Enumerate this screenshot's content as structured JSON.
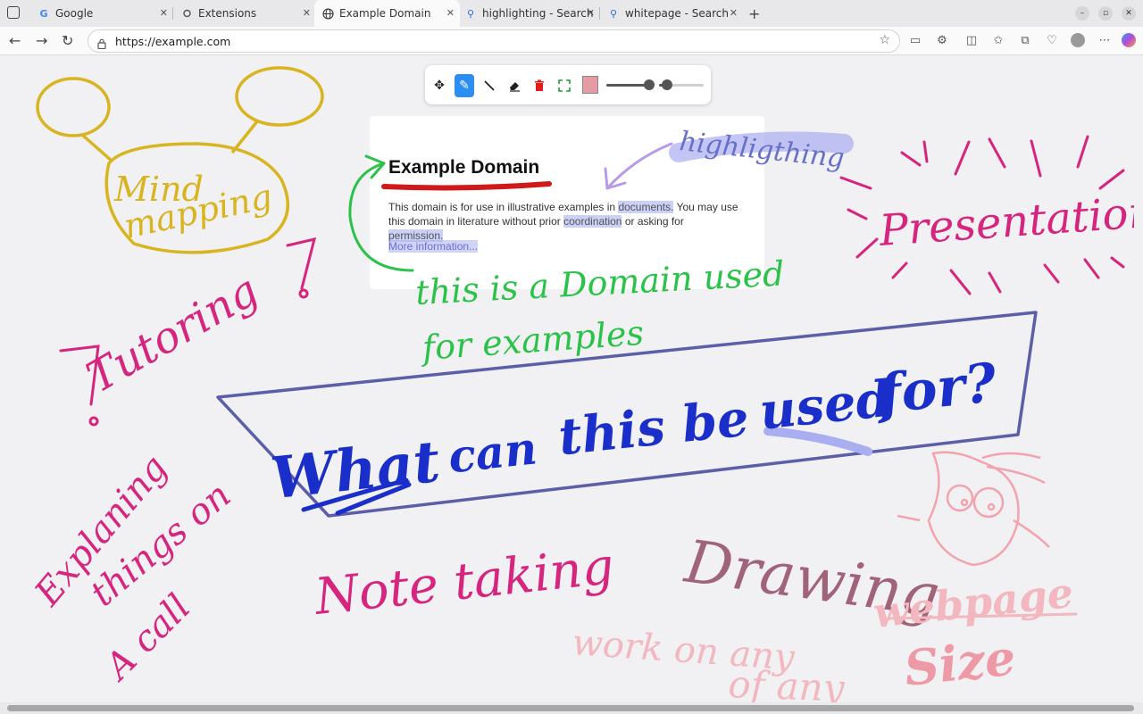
{
  "tabs": [
    {
      "title": "Google",
      "icon": "google-icon",
      "active": false
    },
    {
      "title": "Extensions",
      "icon": "extensions-icon",
      "active": false
    },
    {
      "title": "Example Domain",
      "icon": "globe-icon",
      "active": true
    },
    {
      "title": "highlighting - Search",
      "icon": "search-icon",
      "active": false
    },
    {
      "title": "whitepage - Search",
      "icon": "search-icon",
      "active": false
    }
  ],
  "address": {
    "url": "https://example.com"
  },
  "page": {
    "title": "Example Domain",
    "body_parts": [
      "This domain is for use in illustrative examples in ",
      "documents.",
      " You may use this domain in literature without prior ",
      "coordination",
      " or asking for ",
      "permission."
    ],
    "link": "More information..."
  },
  "draw_toolbar": {
    "active_tool": "pen",
    "pen_color": "#e69aa3",
    "size_1": 0.93,
    "size_2": 0.3
  },
  "annotations": {
    "mind_mapping_1": "Mind",
    "mind_mapping_2": "mapping",
    "tutoring": "Tutoring",
    "presentations": "Presentations",
    "highlighting": "highligthing",
    "domain_note_1": "this is a Domain used",
    "domain_note_2": "for examples",
    "question_1": "What",
    "question_2": "can",
    "question_3": "this be",
    "question_4": "used",
    "question_5": "for?",
    "explaining_1": "Explaning",
    "explaining_2": "things on",
    "explaining_3": "A call",
    "note_taking": "Note taking",
    "drawing": "Drawing",
    "webpage_1": "work on any",
    "webpage_2": "webpage",
    "webpage_3": "of any",
    "webpage_4": "Size"
  },
  "colors": {
    "mind": "#d8b520",
    "pink": "#d6257e",
    "green": "#2bc249",
    "blue": "#1a2fc9",
    "purple_box": "#5c5fa8",
    "drawing": "#a06378",
    "light_pink": "#f2b7bf",
    "highlight": "#a9aef0",
    "red_underline": "#d01a1a"
  }
}
